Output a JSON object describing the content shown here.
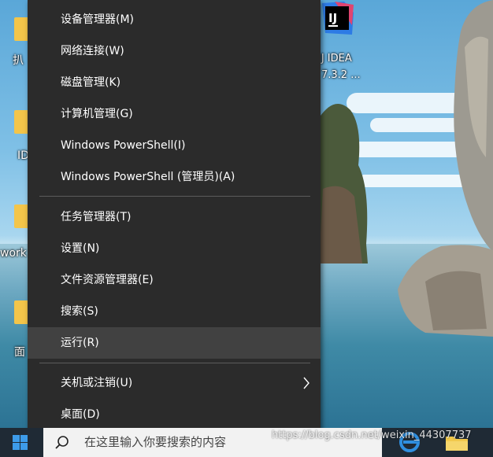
{
  "desktop": {
    "icons": [
      {
        "label": "扒"
      },
      {
        "label": "ID"
      },
      {
        "label": "work"
      },
      {
        "label": "面"
      }
    ],
    "intellij": {
      "label_line1": "IJ IDEA",
      "label_line2": "7.3.2 ..."
    }
  },
  "context_menu": {
    "items": [
      {
        "label": "设备管理器(M)"
      },
      {
        "label": "网络连接(W)"
      },
      {
        "label": "磁盘管理(K)"
      },
      {
        "label": "计算机管理(G)"
      },
      {
        "label": "Windows PowerShell(I)"
      },
      {
        "label": "Windows PowerShell (管理员)(A)"
      },
      {
        "label": "任务管理器(T)"
      },
      {
        "label": "设置(N)"
      },
      {
        "label": "文件资源管理器(E)"
      },
      {
        "label": "搜索(S)"
      },
      {
        "label": "运行(R)"
      },
      {
        "label": "关机或注销(U)",
        "submenu": true
      },
      {
        "label": "桌面(D)"
      }
    ],
    "highlighted_item": "运行(R)"
  },
  "taskbar": {
    "search_placeholder": "在这里输入你要搜索的内容",
    "watermark": "https://blog.csdn.net/weixin_44307737"
  },
  "colors": {
    "menu_bg": "#2b2b2b",
    "menu_highlight": "#414141",
    "menu_text": "#ffffff",
    "taskbar_bg": "#1f2a35",
    "start_accent": "#3d9be9"
  }
}
